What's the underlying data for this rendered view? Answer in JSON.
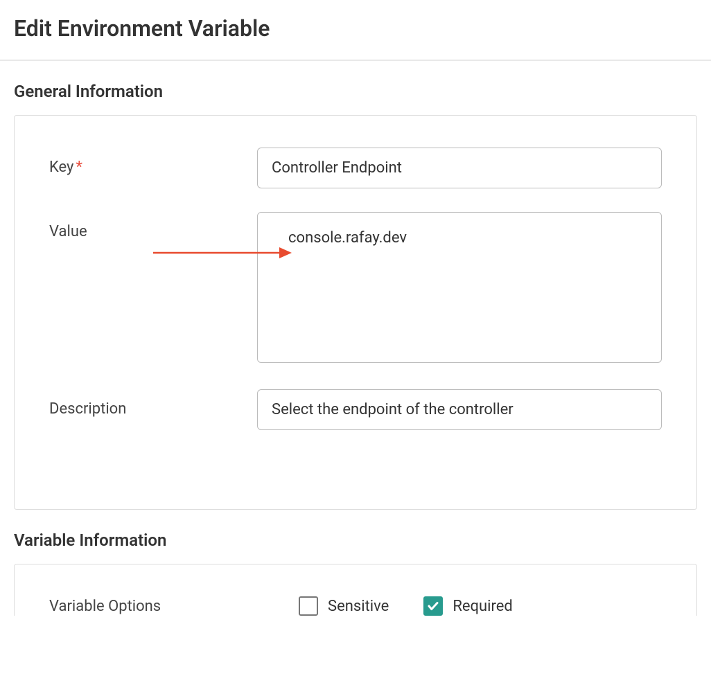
{
  "page": {
    "title": "Edit Environment Variable"
  },
  "sections": {
    "general": {
      "title": "General Information",
      "fields": {
        "key": {
          "label": "Key",
          "required": true,
          "value": "Controller Endpoint"
        },
        "value": {
          "label": "Value",
          "value": "console.rafay.dev"
        },
        "description": {
          "label": "Description",
          "value": "Select the endpoint of the controller"
        }
      }
    },
    "variable": {
      "title": "Variable Information",
      "options": {
        "label": "Variable Options",
        "sensitive": {
          "label": "Sensitive",
          "checked": false
        },
        "required": {
          "label": "Required",
          "checked": true
        }
      }
    }
  },
  "annotation": {
    "arrow_color": "#e84b2f"
  }
}
